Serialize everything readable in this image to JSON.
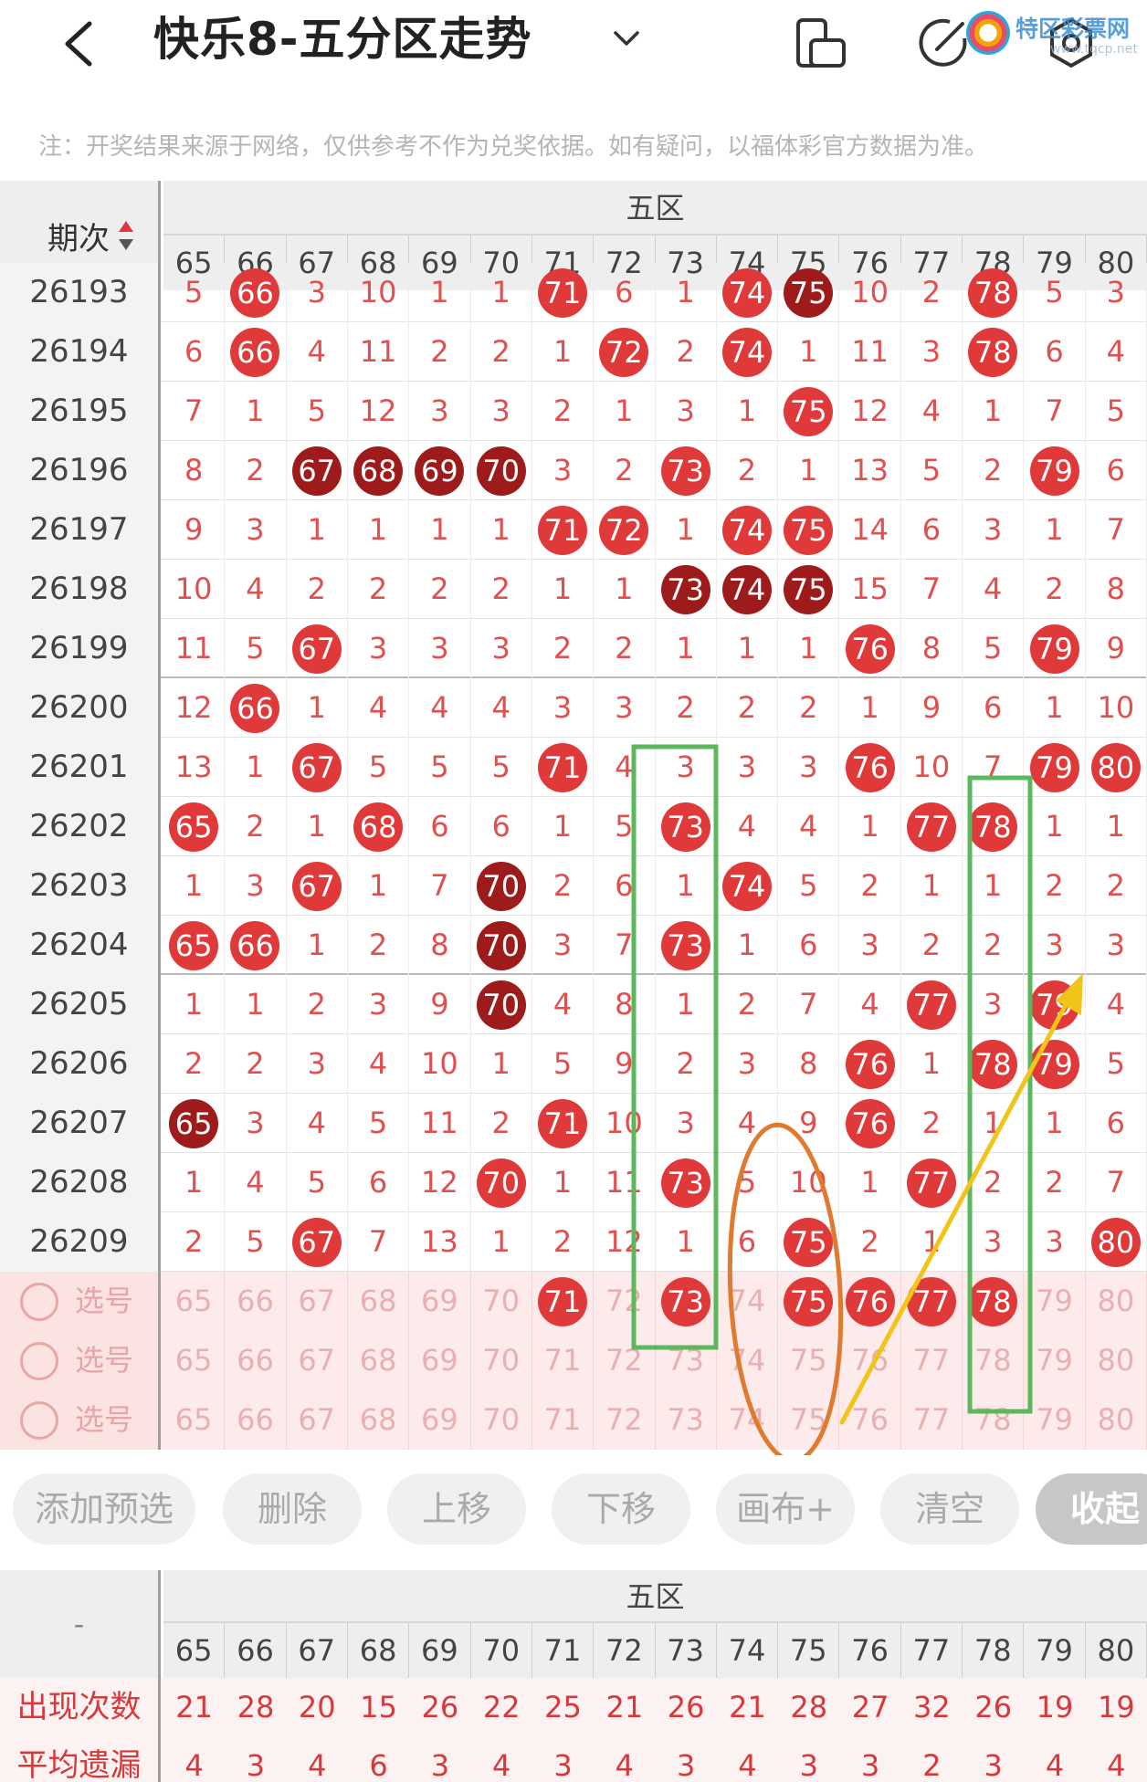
{
  "header": {
    "title": "快乐8-五分区走势",
    "logo_text": "特区彩票网",
    "logo_sub": "www.tqcp.net"
  },
  "note": "注：开奖结果来源于网络，仅供参考不作为兑奖依据。如有疑问，以福体彩官方数据为准。",
  "table": {
    "issue_header": "期次",
    "zone_label": "五区",
    "columns": [
      "65",
      "66",
      "67",
      "68",
      "69",
      "70",
      "71",
      "72",
      "73",
      "74",
      "75",
      "76",
      "77",
      "78",
      "79",
      "80"
    ],
    "rows": [
      {
        "issue": "26193",
        "cells": [
          "5",
          {
            "b": "66",
            "t": "red"
          },
          "3",
          "10",
          "1",
          "1",
          {
            "b": "71",
            "t": "red"
          },
          "6",
          "1",
          {
            "b": "74",
            "t": "red"
          },
          {
            "b": "75",
            "t": "dark"
          },
          "10",
          "2",
          {
            "b": "78",
            "t": "red"
          },
          "5",
          "3"
        ]
      },
      {
        "issue": "26194",
        "cells": [
          "6",
          {
            "b": "66",
            "t": "red"
          },
          "4",
          "11",
          "2",
          "2",
          "1",
          {
            "b": "72",
            "t": "red"
          },
          "2",
          {
            "b": "74",
            "t": "red"
          },
          "1",
          "11",
          "3",
          {
            "b": "78",
            "t": "red"
          },
          "6",
          "4"
        ]
      },
      {
        "issue": "26195",
        "cells": [
          "7",
          "1",
          "5",
          "12",
          "3",
          "3",
          "2",
          "1",
          "3",
          "1",
          {
            "b": "75",
            "t": "red"
          },
          "12",
          "4",
          "1",
          "7",
          "5"
        ]
      },
      {
        "issue": "26196",
        "cells": [
          "8",
          "2",
          {
            "b": "67",
            "t": "dark"
          },
          {
            "b": "68",
            "t": "dark"
          },
          {
            "b": "69",
            "t": "dark"
          },
          {
            "b": "70",
            "t": "dark"
          },
          "3",
          "2",
          {
            "b": "73",
            "t": "red"
          },
          "2",
          "1",
          "13",
          "5",
          "2",
          {
            "b": "79",
            "t": "red"
          },
          "6"
        ]
      },
      {
        "issue": "26197",
        "cells": [
          "9",
          "3",
          "1",
          "1",
          "1",
          "1",
          {
            "b": "71",
            "t": "red"
          },
          {
            "b": "72",
            "t": "red"
          },
          "1",
          {
            "b": "74",
            "t": "red"
          },
          {
            "b": "75",
            "t": "red"
          },
          "14",
          "6",
          "3",
          "1",
          "7"
        ]
      },
      {
        "issue": "26198",
        "cells": [
          "10",
          "4",
          "2",
          "2",
          "2",
          "2",
          "1",
          "1",
          {
            "b": "73",
            "t": "dark"
          },
          {
            "b": "74",
            "t": "dark"
          },
          {
            "b": "75",
            "t": "dark"
          },
          "15",
          "7",
          "4",
          "2",
          "8"
        ]
      },
      {
        "issue": "26199",
        "cells": [
          "11",
          "5",
          {
            "b": "67",
            "t": "red"
          },
          "3",
          "3",
          "3",
          "2",
          "2",
          "1",
          "1",
          "1",
          {
            "b": "76",
            "t": "red"
          },
          "8",
          "5",
          {
            "b": "79",
            "t": "red"
          },
          "9"
        ]
      },
      {
        "issue": "26200",
        "cells": [
          "12",
          {
            "b": "66",
            "t": "red"
          },
          "1",
          "4",
          "4",
          "4",
          "3",
          "3",
          "2",
          "2",
          "2",
          "1",
          "9",
          "6",
          "1",
          "10"
        ]
      },
      {
        "issue": "26201",
        "cells": [
          "13",
          "1",
          {
            "b": "67",
            "t": "red"
          },
          "5",
          "5",
          "5",
          {
            "b": "71",
            "t": "red"
          },
          "4",
          "3",
          "3",
          "3",
          {
            "b": "76",
            "t": "red"
          },
          "10",
          "7",
          {
            "b": "79",
            "t": "red"
          },
          {
            "b": "80",
            "t": "red"
          }
        ]
      },
      {
        "issue": "26202",
        "cells": [
          {
            "b": "65",
            "t": "red"
          },
          "2",
          "1",
          {
            "b": "68",
            "t": "red"
          },
          "6",
          "6",
          "1",
          "5",
          {
            "b": "73",
            "t": "red"
          },
          "4",
          "4",
          "1",
          {
            "b": "77",
            "t": "red"
          },
          {
            "b": "78",
            "t": "red"
          },
          "1",
          "1"
        ]
      },
      {
        "issue": "26203",
        "cells": [
          "1",
          "3",
          {
            "b": "67",
            "t": "red"
          },
          "1",
          "7",
          {
            "b": "70",
            "t": "dark"
          },
          "2",
          "6",
          "1",
          {
            "b": "74",
            "t": "red"
          },
          "5",
          "2",
          "1",
          "1",
          "2",
          "2"
        ]
      },
      {
        "issue": "26204",
        "cells": [
          {
            "b": "65",
            "t": "red"
          },
          {
            "b": "66",
            "t": "red"
          },
          "1",
          "2",
          "8",
          {
            "b": "70",
            "t": "dark"
          },
          "3",
          "7",
          {
            "b": "73",
            "t": "red"
          },
          "1",
          "6",
          "3",
          "2",
          "2",
          "3",
          "3"
        ]
      },
      {
        "issue": "26205",
        "cells": [
          "1",
          "1",
          "2",
          "3",
          "9",
          {
            "b": "70",
            "t": "dark"
          },
          "4",
          "8",
          "1",
          "2",
          "7",
          "4",
          {
            "b": "77",
            "t": "red"
          },
          "3",
          {
            "b": "79",
            "t": "red"
          },
          "4"
        ]
      },
      {
        "issue": "26206",
        "cells": [
          "2",
          "2",
          "3",
          "4",
          "10",
          "1",
          "5",
          "9",
          "2",
          "3",
          "8",
          {
            "b": "76",
            "t": "red"
          },
          "1",
          {
            "b": "78",
            "t": "red"
          },
          {
            "b": "79",
            "t": "red"
          },
          "5"
        ]
      },
      {
        "issue": "26207",
        "cells": [
          {
            "b": "65",
            "t": "dark"
          },
          "3",
          "4",
          "5",
          "11",
          "2",
          {
            "b": "71",
            "t": "red"
          },
          "10",
          "3",
          "4",
          "9",
          {
            "b": "76",
            "t": "red"
          },
          "2",
          "1",
          "1",
          "6"
        ]
      },
      {
        "issue": "26208",
        "cells": [
          "1",
          "4",
          "5",
          "6",
          "12",
          {
            "b": "70",
            "t": "red"
          },
          "1",
          "11",
          {
            "b": "73",
            "t": "red"
          },
          "5",
          "10",
          "1",
          {
            "b": "77",
            "t": "red"
          },
          "2",
          "2",
          "7"
        ]
      },
      {
        "issue": "26209",
        "cells": [
          "2",
          "5",
          {
            "b": "67",
            "t": "red"
          },
          "7",
          "13",
          "1",
          "2",
          "12",
          "1",
          "6",
          {
            "b": "75",
            "t": "red"
          },
          "2",
          "1",
          "3",
          "3",
          {
            "b": "80",
            "t": "red"
          }
        ]
      }
    ],
    "pick_label": "选号",
    "pick_rows": [
      [
        "65",
        "66",
        "67",
        "68",
        "69",
        "70",
        {
          "b": "71",
          "t": "red"
        },
        "72",
        {
          "b": "73",
          "t": "red"
        },
        "74",
        {
          "b": "75",
          "t": "red"
        },
        {
          "b": "76",
          "t": "red"
        },
        {
          "b": "77",
          "t": "red"
        },
        {
          "b": "78",
          "t": "red"
        },
        "79",
        "80"
      ],
      [
        "65",
        "66",
        "67",
        "68",
        "69",
        "70",
        "71",
        "72",
        "73",
        "74",
        "75",
        "76",
        "77",
        "78",
        "79",
        "80"
      ],
      [
        "65",
        "66",
        "67",
        "68",
        "69",
        "70",
        "71",
        "72",
        "73",
        "74",
        "75",
        "76",
        "77",
        "78",
        "79",
        "80"
      ]
    ]
  },
  "buttons": {
    "add": "添加预选",
    "delete": "删除",
    "up": "上移",
    "down": "下移",
    "canvas": "画布+",
    "clear": "清空",
    "collapse": "收起"
  },
  "stats": {
    "corner": "-",
    "zone_label": "五区",
    "columns": [
      "65",
      "66",
      "67",
      "68",
      "69",
      "70",
      "71",
      "72",
      "73",
      "74",
      "75",
      "76",
      "77",
      "78",
      "79",
      "80"
    ],
    "appear_label": "出现次数",
    "appear": [
      "21",
      "28",
      "20",
      "15",
      "26",
      "22",
      "25",
      "21",
      "26",
      "21",
      "28",
      "27",
      "32",
      "26",
      "19",
      "19"
    ],
    "avg_label": "平均遗漏",
    "avg": [
      "4",
      "3",
      "4",
      "6",
      "3",
      "4",
      "3",
      "4",
      "3",
      "4",
      "3",
      "3",
      "2",
      "3",
      "4",
      "4"
    ]
  },
  "colors": {
    "ball_red": "#e0393a",
    "ball_dark": "#9e1b1b",
    "annotation_green": "#5cb85c",
    "annotation_orange": "#e07a2e",
    "annotation_yellow": "#f2c318"
  }
}
